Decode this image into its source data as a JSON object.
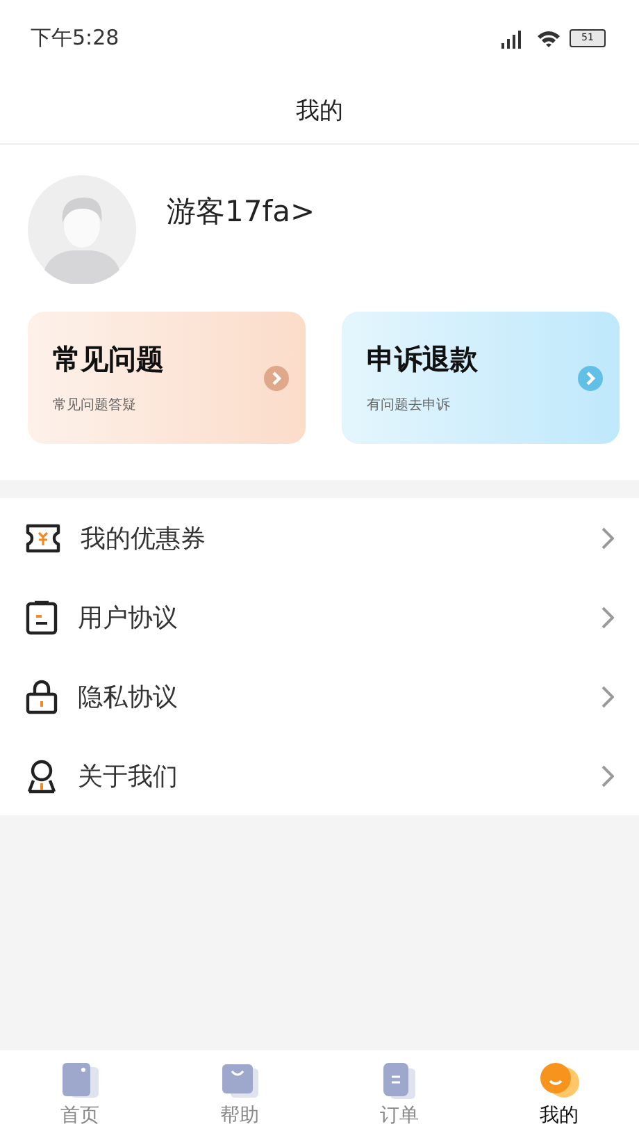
{
  "status_bar": {
    "time": "下午5:28",
    "battery": "51"
  },
  "header": {
    "title": "我的"
  },
  "profile": {
    "name": "游客17fa>"
  },
  "cards": [
    {
      "kind": "warm",
      "title": "常见问题",
      "subtitle": "常见问题答疑"
    },
    {
      "kind": "cool",
      "title": "申诉退款",
      "subtitle": "有问题去申诉"
    }
  ],
  "menu": [
    {
      "kind": "coupon",
      "label": "我的优惠券"
    },
    {
      "kind": "document",
      "label": "用户协议"
    },
    {
      "kind": "lock",
      "label": "隐私协议"
    },
    {
      "kind": "person",
      "label": "关于我们"
    }
  ],
  "tabs": [
    {
      "kind": "photo",
      "label": "首页",
      "selected": false
    },
    {
      "kind": "bag",
      "label": "帮助",
      "selected": false
    },
    {
      "kind": "clipboard",
      "label": "订单",
      "selected": false
    },
    {
      "kind": "smile",
      "label": "我的",
      "selected": true
    }
  ]
}
